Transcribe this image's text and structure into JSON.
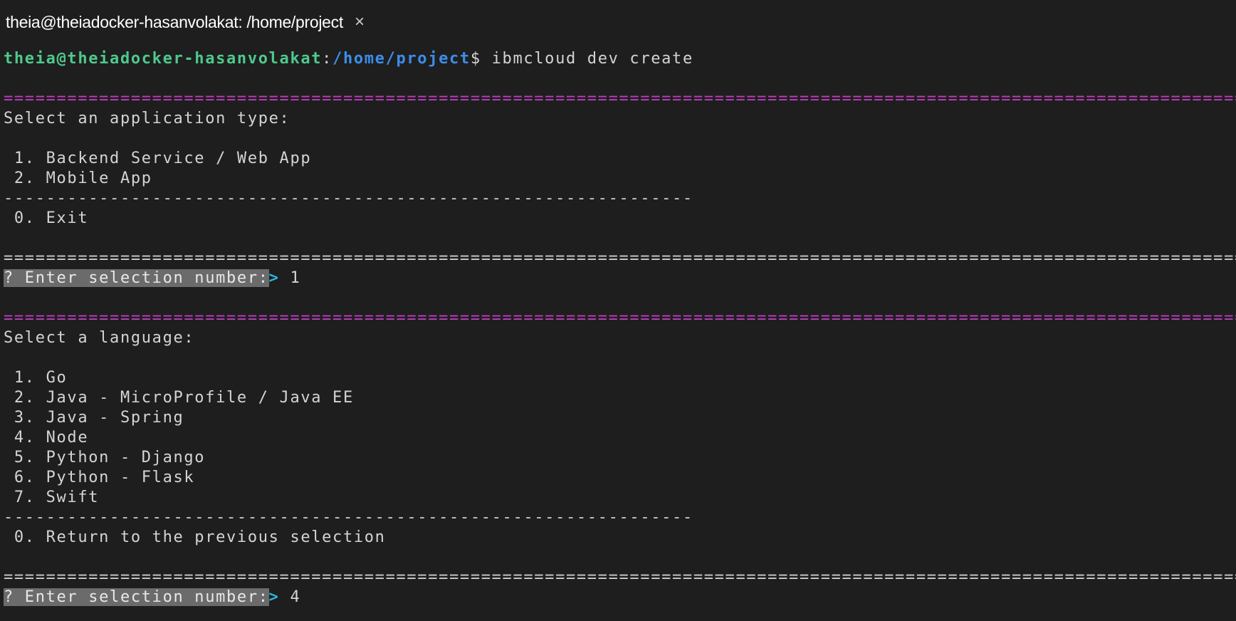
{
  "tab": {
    "title": "theia@theiadocker-hasanvolakat: /home/project",
    "close": "×"
  },
  "prompt": {
    "user_host": "theia@theiadocker-hasanvolakat",
    "colon": ":",
    "path": "/home/project",
    "dollar": "$",
    "command": " ibmcloud dev create"
  },
  "separator_eq": "==========================================================================================================================",
  "separator_dash": "-----------------------------------------------------------------",
  "app_type": {
    "heading": "Select an application type:",
    "options": [
      " 1. Backend Service / Web App",
      " 2. Mobile App"
    ],
    "exit": " 0. Exit",
    "question": "? Enter selection number:",
    "arrow": ">",
    "answer": " 1"
  },
  "language": {
    "heading": "Select a language:",
    "options": [
      " 1. Go",
      " 2. Java - MicroProfile / Java EE",
      " 3. Java - Spring",
      " 4. Node",
      " 5. Python - Django",
      " 6. Python - Flask",
      " 7. Swift"
    ],
    "back": " 0. Return to the previous selection",
    "question": "? Enter selection number:",
    "arrow": ">",
    "answer": " 4"
  },
  "colors": {
    "background": "#1e1e1e",
    "user": "#4ec98d",
    "path": "#3b8eea",
    "separator": "#bc3fbc",
    "highlight": "#6b6b6b",
    "arrow": "#29b8db"
  }
}
